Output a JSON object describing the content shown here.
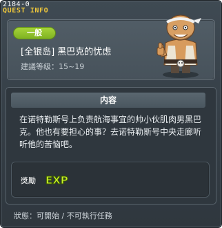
{
  "window": {
    "id_label": "2184-0",
    "title": "QUEST INFO"
  },
  "quest": {
    "category": "一般",
    "name": "[全银岛] 黑巴克的忧虑",
    "level": "建議等级：15~19"
  },
  "content": {
    "header": "内容",
    "description": "在诺特勒斯号上负责航海事宜的帅小伙肌肉男黑巴克。他也有要担心的事？去诺特勒斯号中央走廊听听他的苦恼吧。"
  },
  "reward": {
    "label": "獎勵",
    "icon": "exp-icon",
    "icon_text": "EXP"
  },
  "status": {
    "text": "狀態：可開始 / 不可執行任務"
  },
  "colors": {
    "title": "#f2c93a",
    "badge": "#8bbf2a",
    "exp": "#c6ef2a"
  }
}
